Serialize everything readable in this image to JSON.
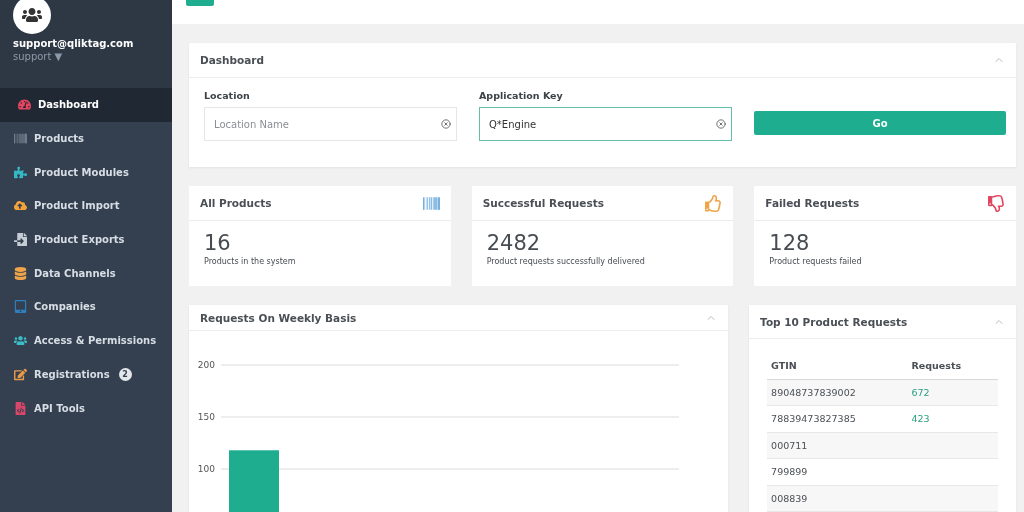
{
  "user": {
    "email": "support@qliktag.com",
    "role": "support ▼"
  },
  "sidebar": {
    "items": [
      {
        "label": "Dashboard",
        "selected": true
      },
      {
        "label": "Products",
        "selected": false
      },
      {
        "label": "Product Modules",
        "selected": false
      },
      {
        "label": "Product Import",
        "selected": false
      },
      {
        "label": "Product Exports",
        "selected": false
      },
      {
        "label": "Data Channels",
        "selected": false
      },
      {
        "label": "Companies",
        "selected": false
      },
      {
        "label": "Access & Permissions",
        "selected": false
      },
      {
        "label": "Registrations",
        "selected": false,
        "badge": "2"
      },
      {
        "label": "API Tools",
        "selected": false
      }
    ]
  },
  "dashboard": {
    "title": "Dashboard",
    "fields": [
      {
        "label": "Location",
        "placeholder": "Location Name",
        "focused": false
      },
      {
        "label": "Application Key",
        "value": "Q*Engine",
        "focused": true
      }
    ],
    "button": "Go"
  },
  "stats": [
    {
      "title": "All Products",
      "value": "16",
      "caption": "Products in the system"
    },
    {
      "title": "Successful Requests",
      "value": "2482",
      "caption": "Product requests successfully delivered"
    },
    {
      "title": "Failed Requests",
      "value": "128",
      "caption": "Product requests failed"
    }
  ],
  "weekly": {
    "title": "Requests On Weekly Basis",
    "chart_data": {
      "type": "bar",
      "values": [
        118
      ],
      "ylim": [
        0,
        200
      ],
      "yticks": [
        100,
        150,
        200
      ],
      "grid": true
    }
  },
  "top_requests": {
    "title": "Top 10 Product Requests",
    "columns": [
      "GTIN",
      "Requests"
    ],
    "rows": [
      [
        "89048737839002",
        "672"
      ],
      [
        "78839473827385",
        "423"
      ],
      [
        "000711"
      ],
      [
        "799899"
      ],
      [
        "008839"
      ]
    ]
  }
}
